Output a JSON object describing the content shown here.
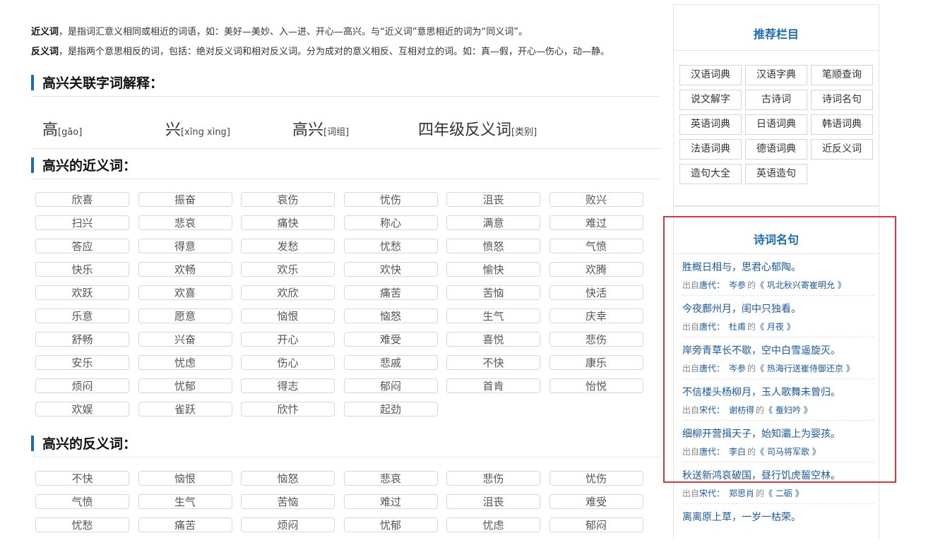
{
  "definitions": {
    "synonym_term": "近义词",
    "synonym_text": "，是指词汇意义相同或相近的词语，如：美好—美妙、入—进、开心—高兴。与“近义词”意思相近的词为“同义词”。",
    "antonym_term": "反义词",
    "antonym_text": "，是指两个意思相反的词，包括：绝对反义词和相对反义词。分为成对的意义相反、互相对立的词。如：真—假，开心—伤心，动—静。"
  },
  "section1": {
    "title": "高兴关联字词解释："
  },
  "chars": [
    {
      "main": "高",
      "sub": "[gāo]"
    },
    {
      "main": "兴",
      "sub": "[xīng xìng]"
    },
    {
      "main": "高兴",
      "sub": "[词组]"
    },
    {
      "main": "四年级反义词",
      "sub": "[类别]"
    }
  ],
  "section2": {
    "title": "高兴的近义词："
  },
  "synonyms": [
    "欣喜",
    "振奋",
    "哀伤",
    "忧伤",
    "沮丧",
    "败兴",
    "扫兴",
    "悲哀",
    "痛快",
    "称心",
    "满意",
    "难过",
    "答应",
    "得意",
    "发愁",
    "忧愁",
    "愤怒",
    "气愤",
    "快乐",
    "欢畅",
    "欢乐",
    "欢快",
    "愉快",
    "欢腾",
    "欢跃",
    "欢喜",
    "欢欣",
    "痛苦",
    "苦恼",
    "快活",
    "乐意",
    "愿意",
    "恼恨",
    "恼怒",
    "生气",
    "庆幸",
    "舒畅",
    "兴奋",
    "开心",
    "难受",
    "喜悦",
    "悲伤",
    "安乐",
    "忧虑",
    "伤心",
    "悲戚",
    "不快",
    "康乐",
    "烦闷",
    "忧郁",
    "得志",
    "郁闷",
    "首肯",
    "怡悦",
    "欢娱",
    "雀跃",
    "欣忭",
    "起劲"
  ],
  "section3": {
    "title": "高兴的反义词："
  },
  "antonyms": [
    "不快",
    "恼恨",
    "恼怒",
    "悲哀",
    "悲伤",
    "忧伤",
    "气愤",
    "生气",
    "苦恼",
    "难过",
    "沮丧",
    "难受",
    "忧愁",
    "痛苦",
    "烦闷",
    "忧郁",
    "忧虑",
    "郁闷"
  ],
  "sidebar": {
    "recommend_title": "推荐栏目",
    "links": [
      "汉语词典",
      "汉语字典",
      "笔顺查询",
      "说文解字",
      "古诗词",
      "诗词名句",
      "英语词典",
      "日语词典",
      "韩语词典",
      "法语词典",
      "德语词典",
      "近反义词",
      "造句大全",
      "英语造句"
    ],
    "poems_title": "诗词名句",
    "poems": [
      {
        "line": "胜概日相与，思君心郁陶。",
        "prefix": "出自",
        "dynasty": "唐代：",
        "author": "岑参",
        "de": "的",
        "title": "《 巩北秋兴寄崔明允 》"
      },
      {
        "line": "今夜鄜州月，闺中只独看。",
        "prefix": "出自",
        "dynasty": "唐代：",
        "author": "杜甫",
        "de": "的",
        "title": "《 月夜 》"
      },
      {
        "line": "岸旁青草长不歇，空中白雪遥旋灭。",
        "prefix": "出自",
        "dynasty": "唐代：",
        "author": "岑参",
        "de": "的",
        "title": "《 热海行送崔侍御还京 》"
      },
      {
        "line": "不信楼头杨柳月，玉人歌舞未曾归。",
        "prefix": "出自",
        "dynasty": "宋代：",
        "author": "谢枋得",
        "de": "的",
        "title": "《 蚕妇吟 》"
      },
      {
        "line": "细柳开营揖天子，始知灞上为婴孩。",
        "prefix": "出自",
        "dynasty": "唐代：",
        "author": "李白",
        "de": "的",
        "title": "《 司马将军歌 》"
      },
      {
        "line": "秋送新鸿哀破国，昼行饥虎齧空林。",
        "prefix": "出自",
        "dynasty": "宋代：",
        "author": "郑思肖",
        "de": "的",
        "title": "《 二砺 》"
      },
      {
        "line": "离离原上草，一岁一枯荣。",
        "prefix": "",
        "dynasty": "",
        "author": "",
        "de": "",
        "title": ""
      }
    ]
  },
  "colors": {
    "accent": "#1a6bb3",
    "highlight": "#d9363e"
  }
}
